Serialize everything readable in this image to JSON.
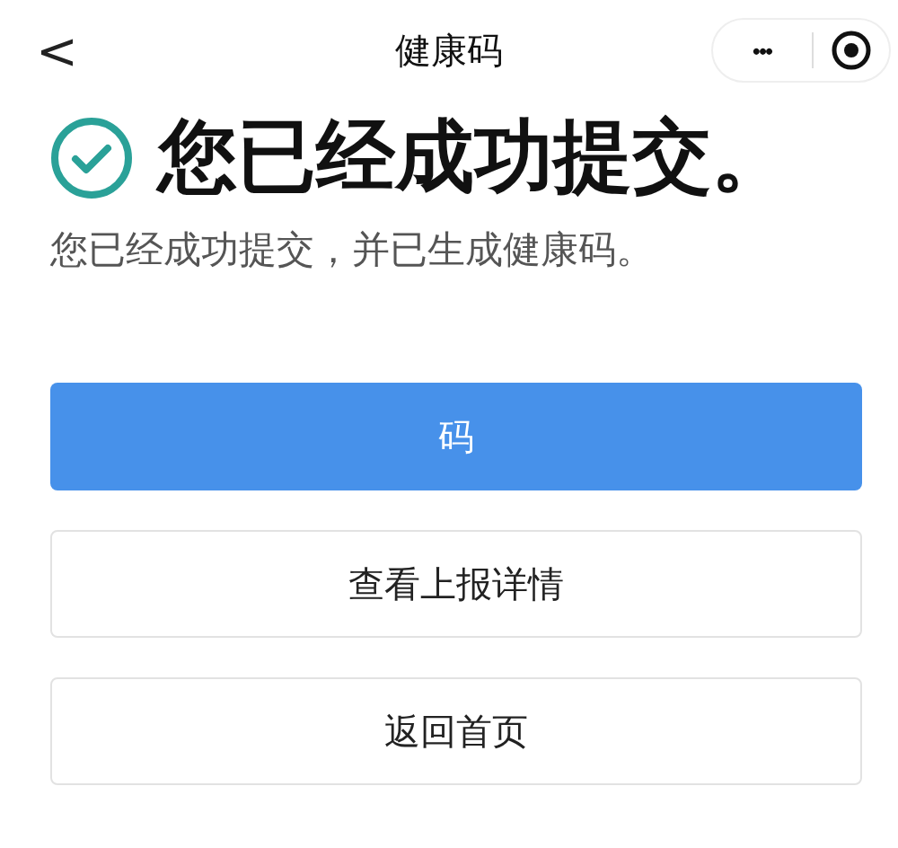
{
  "nav": {
    "back": "<",
    "title": "健康码",
    "more": "•••"
  },
  "result": {
    "heading": "您已经成功提交。",
    "message": "您已经成功提交，并已生成健康码。"
  },
  "buttons": [
    {
      "label": "码",
      "kind": "primary"
    },
    {
      "label": "查看上报详情",
      "kind": "secondary"
    },
    {
      "label": "返回首页",
      "kind": "secondary"
    }
  ]
}
